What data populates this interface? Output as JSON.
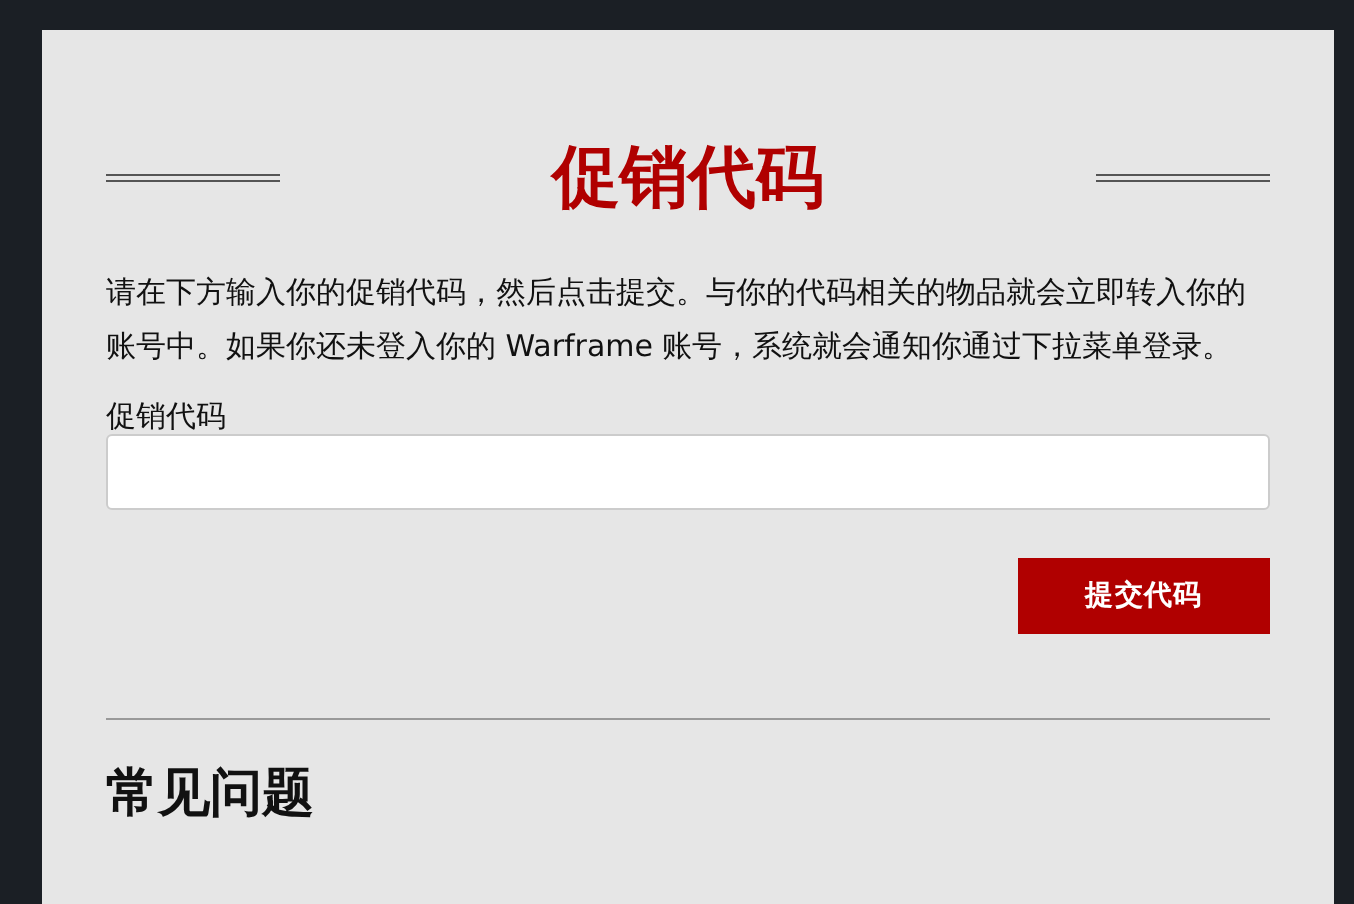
{
  "title": "促销代码",
  "description": "请在下方输入你的促销代码，然后点击提交。与你的代码相关的物品就会立即转入你的账号中。如果你还未登入你的 Warframe 账号，系统就会通知你通过下拉菜单登录。",
  "field": {
    "label": "促销代码"
  },
  "submit_button": "提交代码",
  "faq_heading": "常见问题"
}
